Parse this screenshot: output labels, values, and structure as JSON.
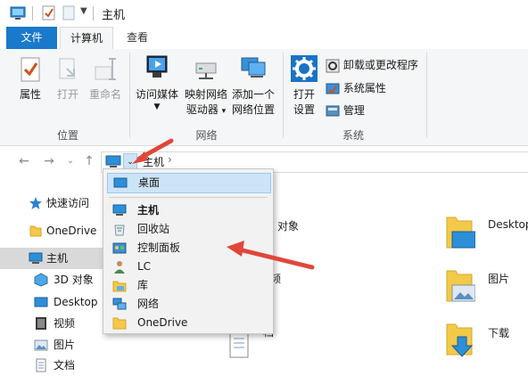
{
  "window": {
    "title": "主机"
  },
  "tabs": [
    {
      "label": "文件"
    },
    {
      "label": "计算机"
    },
    {
      "label": "查看"
    }
  ],
  "ribbon": {
    "location": {
      "group_label": "位置",
      "buttons": [
        {
          "label": "属性"
        },
        {
          "label": "打开"
        },
        {
          "label": "重命名"
        }
      ]
    },
    "network": {
      "group_label": "网络",
      "buttons": [
        {
          "line1": "访问媒体",
          "line2": ""
        },
        {
          "line1": "映射网络",
          "line2": "驱动器"
        },
        {
          "line1": "添加一个",
          "line2": "网络位置"
        }
      ]
    },
    "system": {
      "group_label": "系统",
      "open_settings_line1": "打开",
      "open_settings_line2": "设置",
      "small_items": [
        {
          "label": "卸载或更改程序"
        },
        {
          "label": "系统属性"
        },
        {
          "label": "管理"
        }
      ]
    }
  },
  "address": {
    "segment": "主机",
    "separator": "›"
  },
  "nav_pane": {
    "items": [
      {
        "label": "快速访问",
        "icon": "star-icon"
      },
      {
        "label": "OneDrive",
        "icon": "folder-icon"
      },
      {
        "label": "主机",
        "icon": "computer-icon",
        "selected": true
      },
      {
        "label": "3D 对象",
        "icon": "cube-icon"
      },
      {
        "label": "Desktop",
        "icon": "desktop-icon"
      },
      {
        "label": "视频",
        "icon": "video-icon"
      },
      {
        "label": "图片",
        "icon": "picture-icon"
      },
      {
        "label": "文档",
        "icon": "document-icon"
      }
    ]
  },
  "dropdown": {
    "items": [
      {
        "label": "桌面",
        "icon": "desktop-icon",
        "highlighted": true
      },
      {
        "label": "主机",
        "icon": "computer-icon",
        "bold": true
      },
      {
        "label": "回收站",
        "icon": "recycle-bin-icon"
      },
      {
        "label": "控制面板",
        "icon": "control-panel-icon"
      },
      {
        "label": "LC",
        "icon": "user-icon"
      },
      {
        "label": "库",
        "icon": "library-icon"
      },
      {
        "label": "网络",
        "icon": "network-icon"
      },
      {
        "label": "OneDrive",
        "icon": "folder-icon"
      }
    ]
  },
  "content": {
    "items": [
      {
        "label": "对象"
      },
      {
        "label": "频"
      },
      {
        "label": "档"
      },
      {
        "label": "Desktop"
      },
      {
        "label": "图片"
      },
      {
        "label": "下载"
      }
    ]
  },
  "colors": {
    "accent": "#1979ca",
    "arrow": "#e0473a",
    "folder": "#f3c94a",
    "highlight": "#cce4f7"
  }
}
